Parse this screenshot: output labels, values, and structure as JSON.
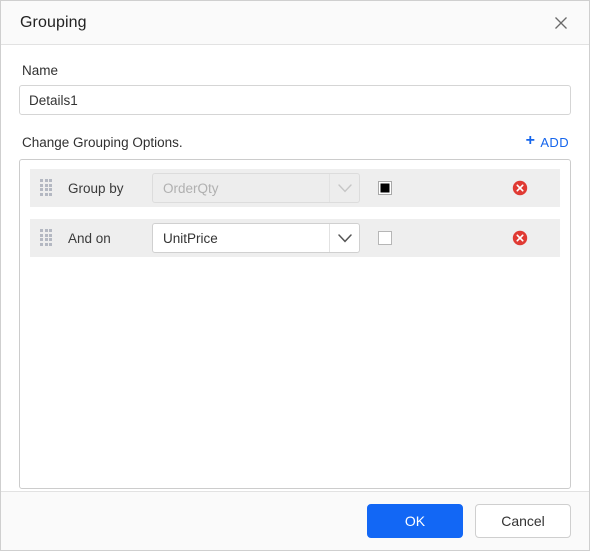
{
  "dialog": {
    "title": "Grouping",
    "close_icon": "close-icon"
  },
  "name_field": {
    "label": "Name",
    "value": "Details1",
    "placeholder": "Name"
  },
  "options_section": {
    "title": "Change Grouping Options.",
    "add_label": "ADD",
    "add_plus": "+"
  },
  "rows": [
    {
      "label": "Group by",
      "select_value": "OrderQty",
      "disabled": true,
      "checked": true,
      "drag_icon": "drag-handle-icon",
      "chevron_icon": "chevron-down-icon",
      "delete_icon": "delete-circle-icon"
    },
    {
      "label": "And on",
      "select_value": "UnitPrice",
      "disabled": false,
      "checked": false,
      "drag_icon": "drag-handle-icon",
      "chevron_icon": "chevron-down-icon",
      "delete_icon": "delete-circle-icon"
    }
  ],
  "footer": {
    "ok_label": "OK",
    "cancel_label": "Cancel"
  },
  "colors": {
    "accent_blue": "#1267f5",
    "link_blue": "#1565ec",
    "delete_red": "#e03a33",
    "row_grey": "#eeeeee",
    "titlebar_grey": "#fafafa"
  }
}
